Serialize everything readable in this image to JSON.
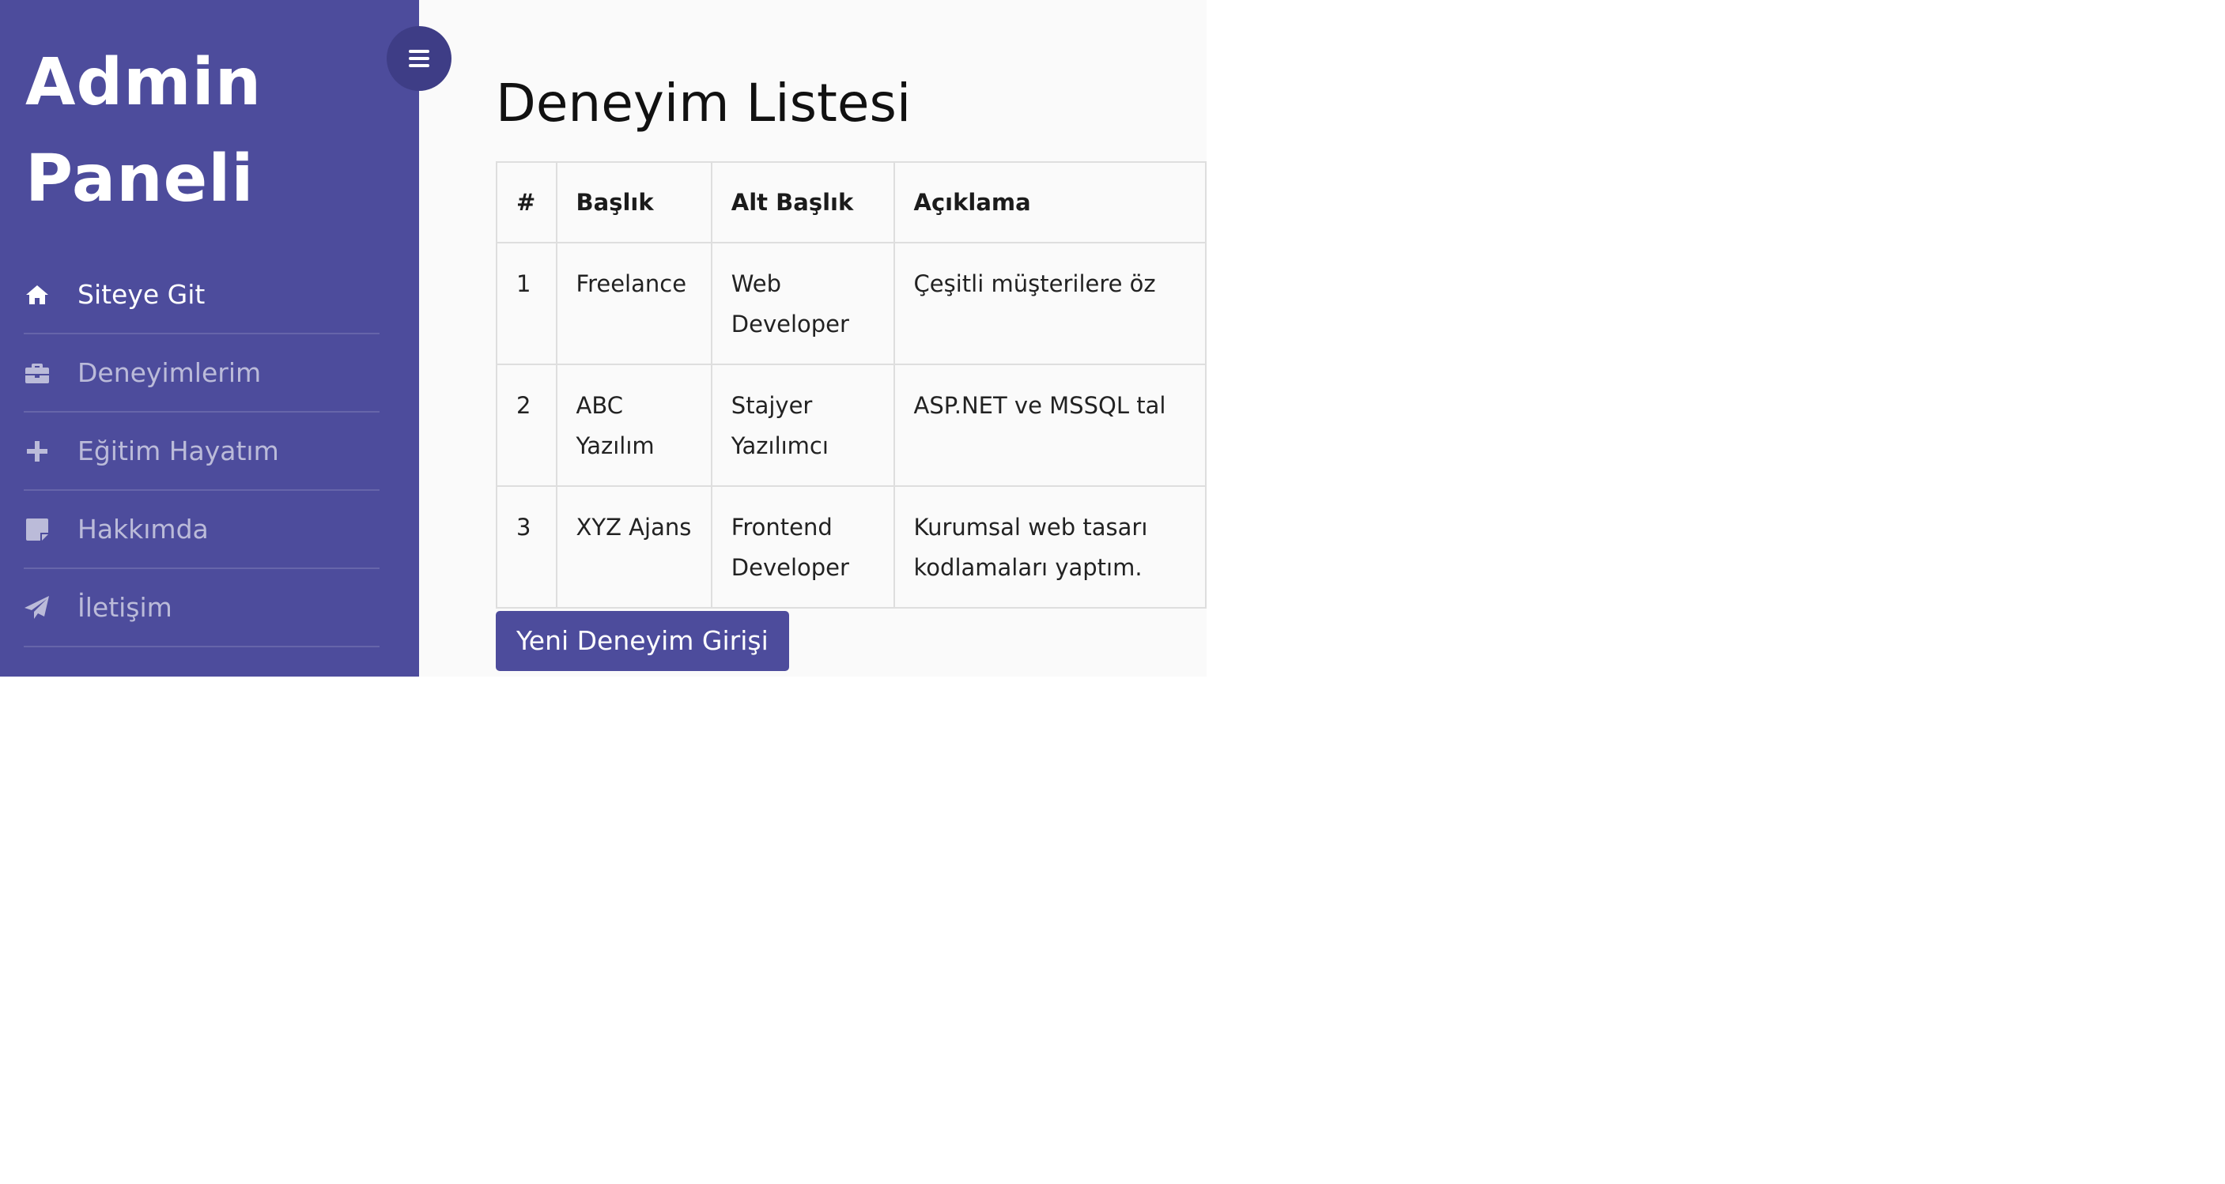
{
  "sidebar": {
    "brand_line1": "Admin",
    "brand_line2": "Paneli",
    "items": [
      {
        "label": "Siteye Git",
        "icon": "home-icon"
      },
      {
        "label": "Deneyimlerim",
        "icon": "briefcase-icon"
      },
      {
        "label": "Eğitim Hayatım",
        "icon": "plus-icon"
      },
      {
        "label": "Hakkımda",
        "icon": "sticky-note-icon"
      },
      {
        "label": "İletişim",
        "icon": "paper-plane-icon"
      }
    ]
  },
  "toggle": {
    "icon": "menu-icon"
  },
  "main": {
    "title": "Deneyim Listesi",
    "table": {
      "headers": [
        "#",
        "Başlık",
        "Alt Başlık",
        "Açıklama"
      ],
      "rows": [
        [
          "1",
          "Freelance",
          "Web Developer",
          "Çeşitli müşterilere öz"
        ],
        [
          "2",
          "ABC Yazılım",
          "Stajyer Yazılımcı",
          "ASP.NET ve MSSQL tal"
        ],
        [
          "3",
          "XYZ Ajans",
          "Frontend Developer",
          "Kurumsal web tasarı kodlamaları yaptım."
        ]
      ]
    },
    "new_button": "Yeni Deneyim Girişi"
  },
  "colors": {
    "sidebar_bg": "#4d4c9c",
    "toggle_bg": "#3e3d86",
    "content_bg": "#fafafa",
    "button_bg": "#4d4c9c"
  }
}
